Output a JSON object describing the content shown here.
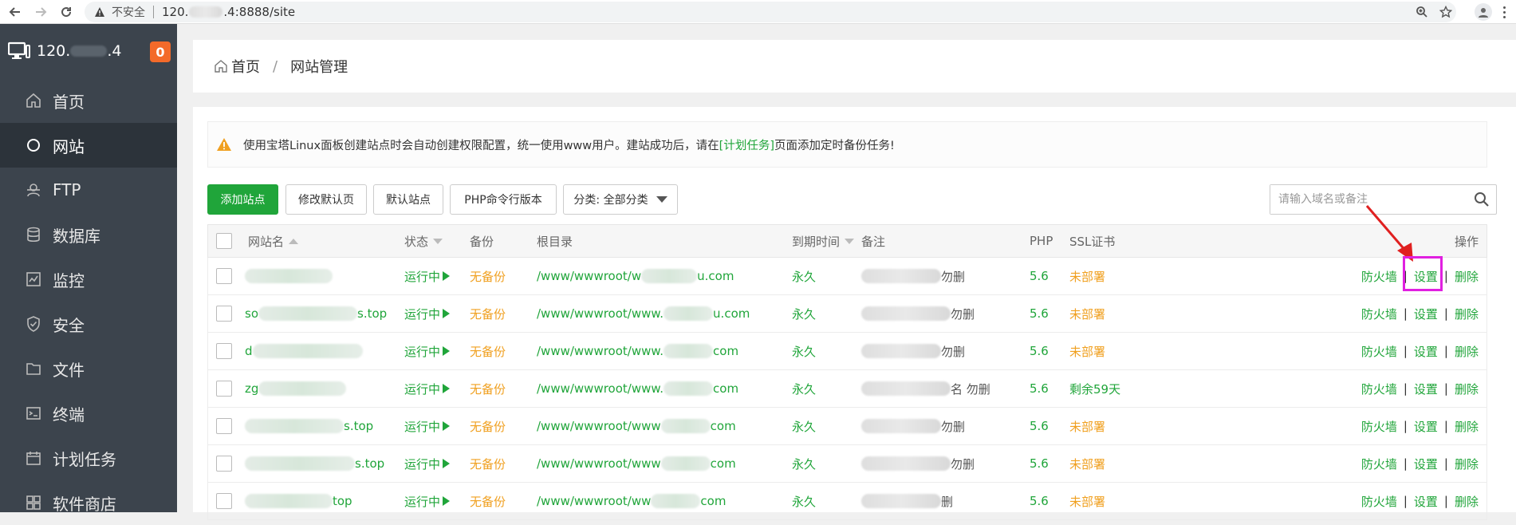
{
  "browser": {
    "security_label": "不安全",
    "url_prefix": "120.",
    "url_suffix": ".4:8888/site"
  },
  "sidebar": {
    "server_prefix": "120.",
    "server_suffix": ".4",
    "badge": "0",
    "items": [
      {
        "label": "首页",
        "icon": "home-icon"
      },
      {
        "label": "网站",
        "icon": "circle-icon",
        "active": true
      },
      {
        "label": "FTP",
        "icon": "ftp-icon"
      },
      {
        "label": "数据库",
        "icon": "database-icon"
      },
      {
        "label": "监控",
        "icon": "monitor-icon"
      },
      {
        "label": "安全",
        "icon": "shield-icon"
      },
      {
        "label": "文件",
        "icon": "folder-icon"
      },
      {
        "label": "终端",
        "icon": "terminal-icon"
      },
      {
        "label": "计划任务",
        "icon": "calendar-icon"
      },
      {
        "label": "软件商店",
        "icon": "apps-icon"
      }
    ]
  },
  "breadcrumb": {
    "home": "首页",
    "current": "网站管理"
  },
  "alert": {
    "text_before": "使用宝塔Linux面板创建站点时会自动创建权限配置，统一使用www用户。建站成功后，请在",
    "link": "[计划任务]",
    "text_after": "页面添加定时备份任务!"
  },
  "toolbar": {
    "add_site": "添加站点",
    "modify_default": "修改默认页",
    "default_site": "默认站点",
    "php_cli": "PHP命令行版本",
    "category": "分类: 全部分类",
    "search_placeholder": "请输入域名或备注"
  },
  "table": {
    "headers": {
      "name": "网站名",
      "status": "状态",
      "backup": "备份",
      "root": "根目录",
      "expire": "到期时间",
      "remark": "备注",
      "php": "PHP",
      "ssl": "SSL证书",
      "ops": "操作"
    },
    "rows": [
      {
        "name_a": "",
        "name_b": "",
        "status": "运行中",
        "backup": "无备份",
        "root_a": "/www/wwwroot/w",
        "root_b": "u.com",
        "expire": "永久",
        "remark_a": "",
        "remark_b": "勿删",
        "php": "5.6",
        "ssl": "未部署",
        "ssl_ok": false
      },
      {
        "name_a": "so",
        "name_b": "s.top",
        "status": "运行中",
        "backup": "无备份",
        "root_a": "/www/wwwroot/www.",
        "root_b": "u.com",
        "expire": "永久",
        "remark_a": "",
        "remark_b": "勿删",
        "php": "5.6",
        "ssl": "未部署",
        "ssl_ok": false
      },
      {
        "name_a": "d",
        "name_b": "",
        "status": "运行中",
        "backup": "无备份",
        "root_a": "/www/wwwroot/www.",
        "root_b": "com",
        "expire": "永久",
        "remark_a": "",
        "remark_b": "勿删",
        "php": "5.6",
        "ssl": "未部署",
        "ssl_ok": false
      },
      {
        "name_a": "zg",
        "name_b": "",
        "status": "运行中",
        "backup": "无备份",
        "root_a": "/www/wwwroot/www.",
        "root_b": "com",
        "expire": "永久",
        "remark_a": "",
        "remark_b": "名 勿删",
        "php": "5.6",
        "ssl": "剩余59天",
        "ssl_ok": true
      },
      {
        "name_a": "",
        "name_b": "s.top",
        "status": "运行中",
        "backup": "无备份",
        "root_a": "/www/wwwroot/www",
        "root_b": "com",
        "expire": "永久",
        "remark_a": "",
        "remark_b": "勿删",
        "php": "5.6",
        "ssl": "未部署",
        "ssl_ok": false
      },
      {
        "name_a": "",
        "name_b": "s.top",
        "status": "运行中",
        "backup": "无备份",
        "root_a": "/www/wwwroot/www",
        "root_b": "com",
        "expire": "永久",
        "remark_a": "",
        "remark_b": "勿删",
        "php": "5.6",
        "ssl": "未部署",
        "ssl_ok": false
      },
      {
        "name_a": "",
        "name_b": "top",
        "status": "运行中",
        "backup": "无备份",
        "root_a": "/www/wwwroot/ww",
        "root_b": "com",
        "expire": "永久",
        "remark_a": "",
        "remark_b": "删",
        "php": "5.6",
        "ssl": "未部署",
        "ssl_ok": false
      }
    ],
    "ops": {
      "firewall": "防火墙",
      "settings": "设置",
      "delete": "删除"
    }
  },
  "colors": {
    "accent": "#20a53a",
    "warning": "#f0a020",
    "sidebar_bg": "#3c444d",
    "badge": "#f36a2a",
    "annotation": "#e020e0"
  }
}
